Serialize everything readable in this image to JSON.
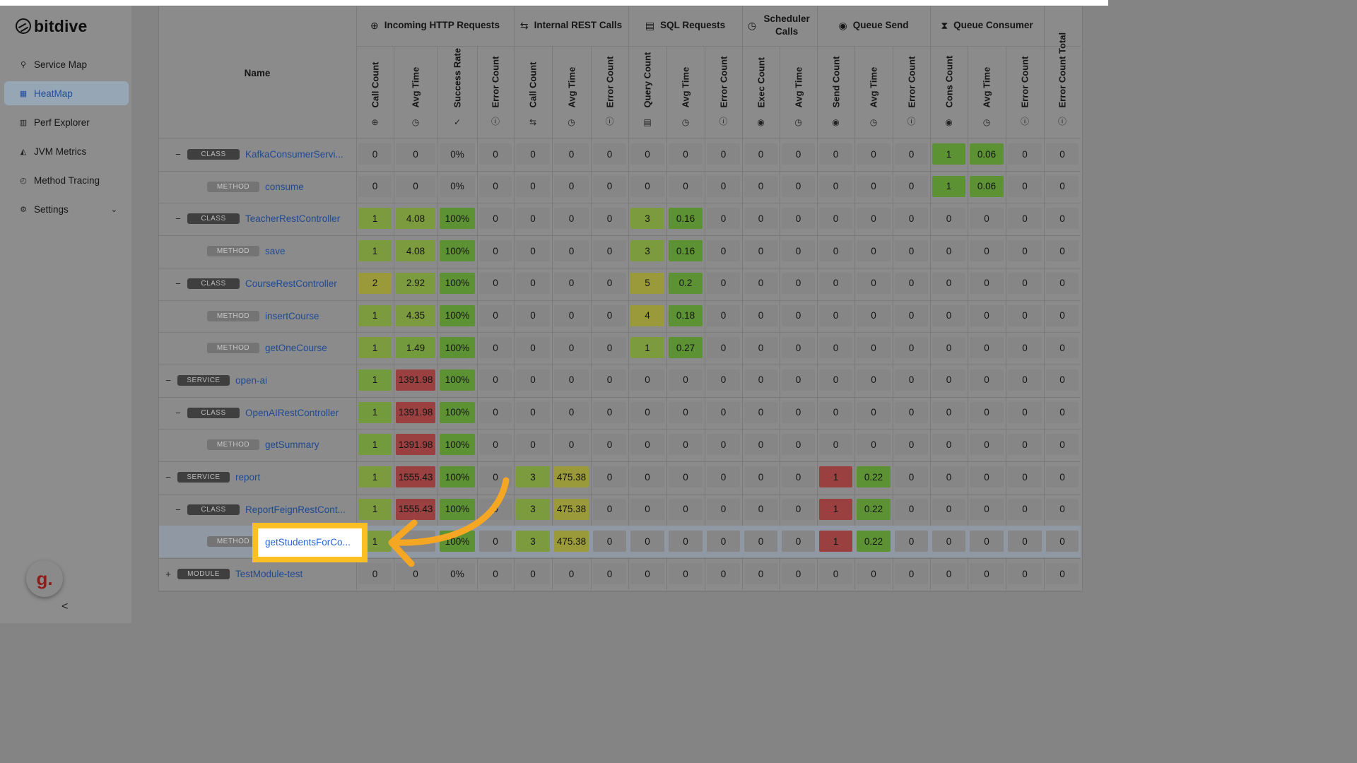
{
  "app": {
    "logo_text": "bitdive"
  },
  "sidebar": {
    "items": [
      {
        "label": "Service Map",
        "icon": "service-map-icon",
        "active": false
      },
      {
        "label": "HeatMap",
        "icon": "heatmap-icon",
        "active": true
      },
      {
        "label": "Perf Explorer",
        "icon": "chart-bar-icon",
        "active": false
      },
      {
        "label": "JVM Metrics",
        "icon": "chart-area-icon",
        "active": false
      },
      {
        "label": "Method Tracing",
        "icon": "history-icon",
        "active": false
      },
      {
        "label": "Settings",
        "icon": "gear-icon",
        "active": false
      }
    ],
    "user_initial": "g.",
    "collapse_glyph": "<"
  },
  "table": {
    "name_header": "Name",
    "groups": [
      {
        "label": "Incoming HTTP Requests",
        "icon": "globe-icon"
      },
      {
        "label": "Internal REST Calls",
        "icon": "swap-icon"
      },
      {
        "label": "SQL Requests",
        "icon": "database-icon"
      },
      {
        "label": "Scheduler Calls",
        "icon": "clock-icon"
      },
      {
        "label": "Queue Send",
        "icon": "play-circle-icon"
      },
      {
        "label": "Queue Consumer",
        "icon": "hourglass-icon"
      }
    ],
    "columns": [
      {
        "label": "Call Count",
        "icon": "globe-icon"
      },
      {
        "label": "Avg Time",
        "icon": "clock-icon"
      },
      {
        "label": "Success Rate",
        "icon": "check-circle-icon"
      },
      {
        "label": "Error Count",
        "icon": "alert-circle-icon"
      },
      {
        "label": "Call Count",
        "icon": "swap-icon"
      },
      {
        "label": "Avg Time",
        "icon": "clock-icon"
      },
      {
        "label": "Error Count",
        "icon": "alert-circle-icon"
      },
      {
        "label": "Query Count",
        "icon": "database-icon"
      },
      {
        "label": "Avg Time",
        "icon": "clock-icon"
      },
      {
        "label": "Error Count",
        "icon": "alert-circle-icon"
      },
      {
        "label": "Exec Count",
        "icon": "play-circle-icon"
      },
      {
        "label": "Avg Time",
        "icon": "clock-icon"
      },
      {
        "label": "Send Count",
        "icon": "play-circle-icon"
      },
      {
        "label": "Avg Time",
        "icon": "clock-icon"
      },
      {
        "label": "Error Count",
        "icon": "alert-circle-icon"
      },
      {
        "label": "Cons Count",
        "icon": "play-circle-icon"
      },
      {
        "label": "Avg Time",
        "icon": "clock-icon"
      },
      {
        "label": "Error Count",
        "icon": "alert-circle-icon"
      },
      {
        "label": "Error Count Total",
        "icon": "alert-circle-icon"
      }
    ],
    "rows": [
      {
        "type": "CLASS",
        "name": "KafkaConsumerServi...",
        "toggle": "−",
        "values": [
          "0",
          "0",
          "0%",
          "0",
          "0",
          "0",
          "0",
          "0",
          "0",
          "0",
          "0",
          "0",
          "0",
          "0",
          "0",
          "1",
          "0.06",
          "0",
          "0"
        ],
        "colors": [
          "n",
          "n",
          "n",
          "n",
          "n",
          "n",
          "n",
          "n",
          "n",
          "n",
          "n",
          "n",
          "n",
          "n",
          "n",
          "g3",
          "g3",
          "n",
          "n"
        ]
      },
      {
        "type": "METHOD",
        "name": "consume",
        "toggle": "",
        "values": [
          "0",
          "0",
          "0%",
          "0",
          "0",
          "0",
          "0",
          "0",
          "0",
          "0",
          "0",
          "0",
          "0",
          "0",
          "0",
          "1",
          "0.06",
          "0",
          "0"
        ],
        "colors": [
          "n",
          "n",
          "n",
          "n",
          "n",
          "n",
          "n",
          "n",
          "n",
          "n",
          "n",
          "n",
          "n",
          "n",
          "n",
          "g3",
          "g3",
          "n",
          "n"
        ]
      },
      {
        "type": "CLASS",
        "name": "TeacherRestController",
        "toggle": "−",
        "values": [
          "1",
          "4.08",
          "100%",
          "0",
          "0",
          "0",
          "0",
          "3",
          "0.16",
          "0",
          "0",
          "0",
          "0",
          "0",
          "0",
          "0",
          "0",
          "0",
          "0"
        ],
        "colors": [
          "g1",
          "g1",
          "g3",
          "n",
          "n",
          "n",
          "n",
          "g1",
          "g3",
          "n",
          "n",
          "n",
          "n",
          "n",
          "n",
          "n",
          "n",
          "n",
          "n"
        ]
      },
      {
        "type": "METHOD",
        "name": "save",
        "toggle": "",
        "values": [
          "1",
          "4.08",
          "100%",
          "0",
          "0",
          "0",
          "0",
          "3",
          "0.16",
          "0",
          "0",
          "0",
          "0",
          "0",
          "0",
          "0",
          "0",
          "0",
          "0"
        ],
        "colors": [
          "g1",
          "g1",
          "g3",
          "n",
          "n",
          "n",
          "n",
          "g1",
          "g3",
          "n",
          "n",
          "n",
          "n",
          "n",
          "n",
          "n",
          "n",
          "n",
          "n"
        ]
      },
      {
        "type": "CLASS",
        "name": "CourseRestController",
        "toggle": "−",
        "values": [
          "2",
          "2.92",
          "100%",
          "0",
          "0",
          "0",
          "0",
          "5",
          "0.2",
          "0",
          "0",
          "0",
          "0",
          "0",
          "0",
          "0",
          "0",
          "0",
          "0"
        ],
        "colors": [
          "y",
          "g1",
          "g3",
          "n",
          "n",
          "n",
          "n",
          "y",
          "g3",
          "n",
          "n",
          "n",
          "n",
          "n",
          "n",
          "n",
          "n",
          "n",
          "n"
        ]
      },
      {
        "type": "METHOD",
        "name": "insertCourse",
        "toggle": "",
        "values": [
          "1",
          "4.35",
          "100%",
          "0",
          "0",
          "0",
          "0",
          "4",
          "0.18",
          "0",
          "0",
          "0",
          "0",
          "0",
          "0",
          "0",
          "0",
          "0",
          "0"
        ],
        "colors": [
          "g1",
          "g1",
          "g3",
          "n",
          "n",
          "n",
          "n",
          "y",
          "g3",
          "n",
          "n",
          "n",
          "n",
          "n",
          "n",
          "n",
          "n",
          "n",
          "n"
        ]
      },
      {
        "type": "METHOD",
        "name": "getOneCourse",
        "toggle": "",
        "values": [
          "1",
          "1.49",
          "100%",
          "0",
          "0",
          "0",
          "0",
          "1",
          "0.27",
          "0",
          "0",
          "0",
          "0",
          "0",
          "0",
          "0",
          "0",
          "0",
          "0"
        ],
        "colors": [
          "g1",
          "g2",
          "g3",
          "n",
          "n",
          "n",
          "n",
          "g1",
          "g3",
          "n",
          "n",
          "n",
          "n",
          "n",
          "n",
          "n",
          "n",
          "n",
          "n"
        ]
      },
      {
        "type": "SERVICE",
        "name": "open-ai",
        "toggle": "−",
        "values": [
          "1",
          "1391.98",
          "100%",
          "0",
          "0",
          "0",
          "0",
          "0",
          "0",
          "0",
          "0",
          "0",
          "0",
          "0",
          "0",
          "0",
          "0",
          "0",
          "0"
        ],
        "colors": [
          "g2",
          "r",
          "g3",
          "n",
          "n",
          "n",
          "n",
          "n",
          "n",
          "n",
          "n",
          "n",
          "n",
          "n",
          "n",
          "n",
          "n",
          "n",
          "n"
        ]
      },
      {
        "type": "CLASS",
        "name": "OpenAIRestController",
        "toggle": "−",
        "values": [
          "1",
          "1391.98",
          "100%",
          "0",
          "0",
          "0",
          "0",
          "0",
          "0",
          "0",
          "0",
          "0",
          "0",
          "0",
          "0",
          "0",
          "0",
          "0",
          "0"
        ],
        "colors": [
          "g2",
          "r",
          "g3",
          "n",
          "n",
          "n",
          "n",
          "n",
          "n",
          "n",
          "n",
          "n",
          "n",
          "n",
          "n",
          "n",
          "n",
          "n",
          "n"
        ]
      },
      {
        "type": "METHOD",
        "name": "getSummary",
        "toggle": "",
        "values": [
          "1",
          "1391.98",
          "100%",
          "0",
          "0",
          "0",
          "0",
          "0",
          "0",
          "0",
          "0",
          "0",
          "0",
          "0",
          "0",
          "0",
          "0",
          "0",
          "0"
        ],
        "colors": [
          "g2",
          "r",
          "g3",
          "n",
          "n",
          "n",
          "n",
          "n",
          "n",
          "n",
          "n",
          "n",
          "n",
          "n",
          "n",
          "n",
          "n",
          "n",
          "n"
        ]
      },
      {
        "type": "SERVICE",
        "name": "report",
        "toggle": "−",
        "values": [
          "1",
          "1555.43",
          "100%",
          "0",
          "3",
          "475.38",
          "0",
          "0",
          "0",
          "0",
          "0",
          "0",
          "1",
          "0.22",
          "0",
          "0",
          "0",
          "0",
          "0"
        ],
        "colors": [
          "g1",
          "r",
          "g3",
          "n",
          "g1",
          "y",
          "n",
          "n",
          "n",
          "n",
          "n",
          "n",
          "r",
          "g3",
          "n",
          "n",
          "n",
          "n",
          "n"
        ]
      },
      {
        "type": "CLASS",
        "name": "ReportFeignRestCont...",
        "toggle": "−",
        "values": [
          "1",
          "1555.43",
          "100%",
          "0",
          "3",
          "475.38",
          "0",
          "0",
          "0",
          "0",
          "0",
          "0",
          "1",
          "0.22",
          "0",
          "0",
          "0",
          "0",
          "0"
        ],
        "colors": [
          "g1",
          "r",
          "g3",
          "n",
          "g1",
          "y",
          "n",
          "n",
          "n",
          "n",
          "n",
          "n",
          "r",
          "g3",
          "n",
          "n",
          "n",
          "n",
          "n"
        ]
      },
      {
        "type": "METHOD",
        "name": "getStudentsForCo...",
        "toggle": "",
        "values": [
          "1",
          "",
          "100%",
          "0",
          "3",
          "475.38",
          "0",
          "0",
          "0",
          "0",
          "0",
          "0",
          "1",
          "0.22",
          "0",
          "0",
          "0",
          "0",
          "0"
        ],
        "colors": [
          "g1",
          "n",
          "g3",
          "n",
          "g1",
          "y",
          "n",
          "n",
          "n",
          "n",
          "n",
          "n",
          "r",
          "g3",
          "n",
          "n",
          "n",
          "n",
          "n"
        ]
      },
      {
        "type": "MODULE",
        "name": "TestModule-test",
        "toggle": "+",
        "values": [
          "0",
          "0",
          "0%",
          "0",
          "0",
          "0",
          "0",
          "0",
          "0",
          "0",
          "0",
          "0",
          "0",
          "0",
          "0",
          "0",
          "0",
          "0",
          "0"
        ],
        "colors": [
          "n",
          "n",
          "n",
          "n",
          "n",
          "n",
          "n",
          "n",
          "n",
          "n",
          "n",
          "n",
          "n",
          "n",
          "n",
          "n",
          "n",
          "n",
          "n"
        ]
      }
    ]
  },
  "callout": {
    "text": "getStudentsForCo..."
  }
}
